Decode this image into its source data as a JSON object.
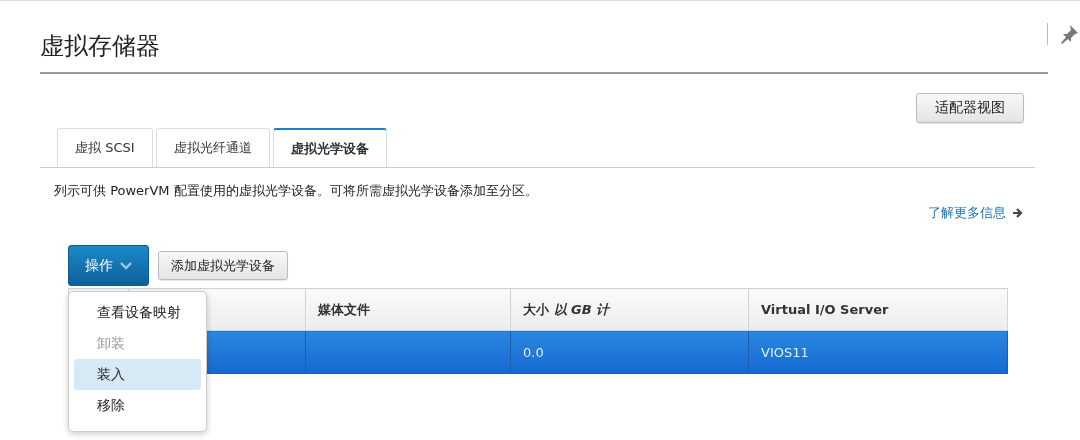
{
  "page": {
    "title": "虚拟存储器"
  },
  "adapter_view_button": "适配器视图",
  "tabs": [
    {
      "label": "虚拟 SCSI",
      "selected": false
    },
    {
      "label": "虚拟光纤通道",
      "selected": false
    },
    {
      "label": "虚拟光学设备",
      "selected": true
    }
  ],
  "description": "列示可供 PowerVM 配置使用的虚拟光学设备。可将所需虚拟光学设备添加至分区。",
  "learn_more_link": "了解更多信息",
  "toolbar": {
    "actions_button": "操作",
    "add_button": "添加虚拟光学设备"
  },
  "actions_menu": [
    {
      "label": "查看设备映射",
      "disabled": false,
      "selected": false
    },
    {
      "label": "卸装",
      "disabled": true,
      "selected": false
    },
    {
      "label": "装入",
      "disabled": false,
      "selected": true
    },
    {
      "label": "移除",
      "disabled": false,
      "selected": false
    }
  ],
  "table": {
    "columns": [
      "",
      "",
      "媒体文件",
      "大小 *以 GB 计*",
      "Virtual I/O Server"
    ],
    "rows": [
      {
        "selected": true,
        "cells": [
          "",
          "",
          "",
          "0.0",
          "VIOS11"
        ]
      }
    ]
  }
}
